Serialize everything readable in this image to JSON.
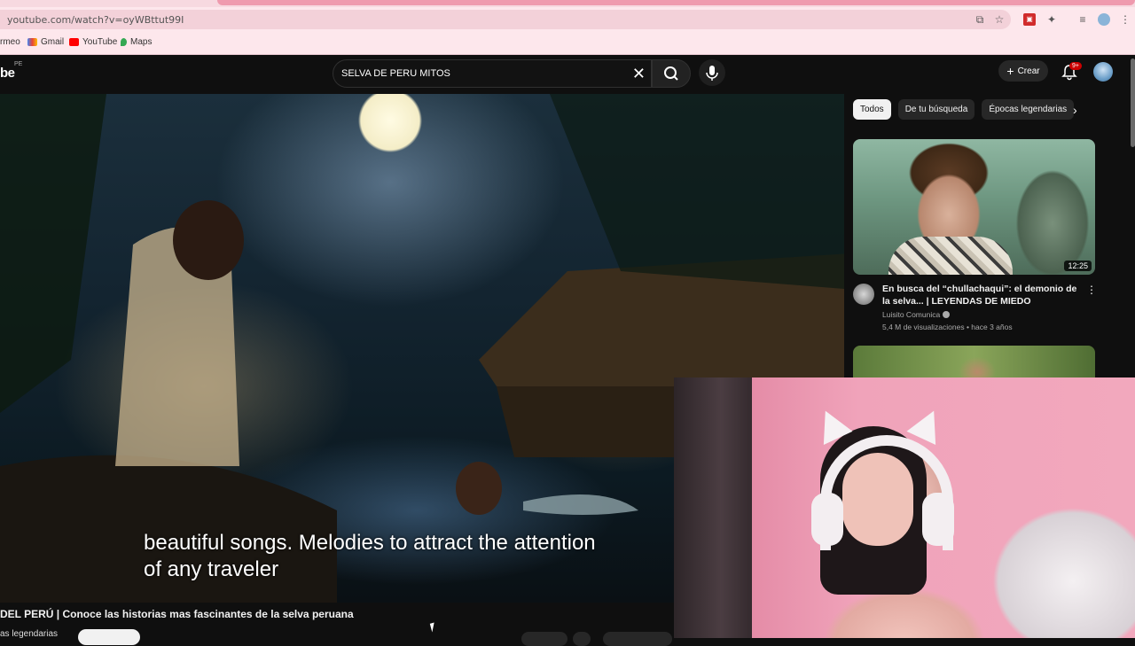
{
  "browser": {
    "url": "youtube.com/watch?v=oyWBttut99I",
    "bookmarks": [
      {
        "label": "rmeo"
      },
      {
        "label": "Gmail"
      },
      {
        "label": "YouTube"
      },
      {
        "label": "Maps"
      }
    ]
  },
  "header": {
    "logo_text": "be",
    "country": "PE",
    "search_value": "SELVA DE PERU MITOS",
    "create_label": "Crear",
    "notification_badge": "9+"
  },
  "player": {
    "subtitle_line1": "beautiful songs.  Melodies to attract the attention",
    "subtitle_line2": "of any traveler",
    "title": "DEL PERÚ | Conoce las historias mas fascinantes de la selva peruana",
    "channel_partial": "as legendarias"
  },
  "chips": [
    "Todos",
    "De tu búsqueda",
    "Épocas legendarias"
  ],
  "recommendations": [
    {
      "title": "En busca del “chullachaqui”: el demonio de la selva... | LEYENDAS DE MIEDO",
      "channel": "Luisito Comunica",
      "stats": "5,4 M de visualizaciones • hace 3 años",
      "duration": "12:25"
    }
  ],
  "colors": {
    "accent_red": "#cc0000",
    "page_bg": "#0f0f0f",
    "chip_bg": "#272727"
  }
}
